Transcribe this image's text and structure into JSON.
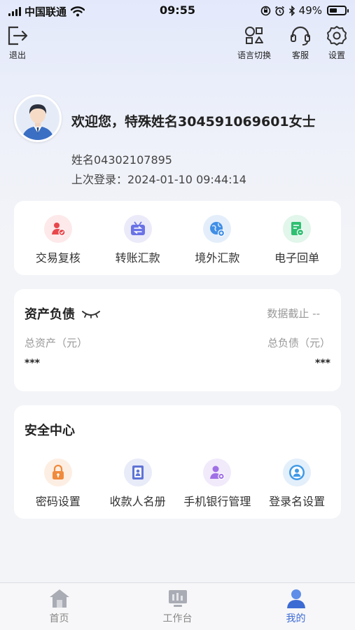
{
  "statusbar": {
    "carrier": "中国联通",
    "time": "09:55",
    "battery": "49%",
    "battery_level": 0.49,
    "icons": [
      "signal-icon",
      "wifi-icon",
      "rotation-lock-icon",
      "alarm-icon",
      "bluetooth-icon",
      "battery-icon"
    ]
  },
  "topbar": {
    "logout_label": "退出",
    "language_label": "语言切换",
    "service_label": "客服",
    "settings_label": "设置"
  },
  "profile": {
    "welcome": "欢迎您，特殊姓名304591069601女士",
    "name": "姓名04302107895",
    "last_login": "上次登录：2024-01-10 09:44:14"
  },
  "quick_actions": [
    {
      "label": "交易复核",
      "icon": "transaction-review-icon",
      "color": "#e8474c",
      "bg": "#fde9ea"
    },
    {
      "label": "转账汇款",
      "icon": "transfer-icon",
      "color": "#6a72e6",
      "bg": "#ebeaf9"
    },
    {
      "label": "境外汇款",
      "icon": "overseas-remit-icon",
      "color": "#3f8ee6",
      "bg": "#e4eefb"
    },
    {
      "label": "电子回单",
      "icon": "e-receipt-icon",
      "color": "#2fbf72",
      "bg": "#e2f6eb"
    }
  ],
  "assets": {
    "title": "资产负债",
    "date_label": "数据截止 --",
    "total_assets_label": "总资产（元）",
    "total_liabilities_label": "总负债（元）",
    "total_assets_value": "***",
    "total_liabilities_value": "***"
  },
  "security": {
    "title": "安全中心",
    "items": [
      {
        "label": "密码设置",
        "icon": "lock-icon",
        "color": "#f08a3c",
        "bg": "#fdeee3"
      },
      {
        "label": "收款人名册",
        "icon": "payee-book-icon",
        "color": "#5f74d6",
        "bg": "#e8ebf8"
      },
      {
        "label": "手机银行管理",
        "icon": "user-settings-icon",
        "color": "#a070e6",
        "bg": "#f1eafb"
      },
      {
        "label": "登录名设置",
        "icon": "user-circle-icon",
        "color": "#3f9ae6",
        "bg": "#e3effb"
      }
    ]
  },
  "tabbar": {
    "tabs": [
      {
        "label": "首页",
        "icon": "home-icon",
        "active": false
      },
      {
        "label": "工作台",
        "icon": "workbench-icon",
        "active": false
      },
      {
        "label": "我的",
        "icon": "me-icon",
        "active": true
      }
    ]
  },
  "colors": {
    "accent": "#3d6bd4",
    "background": "#f3f4f8"
  }
}
